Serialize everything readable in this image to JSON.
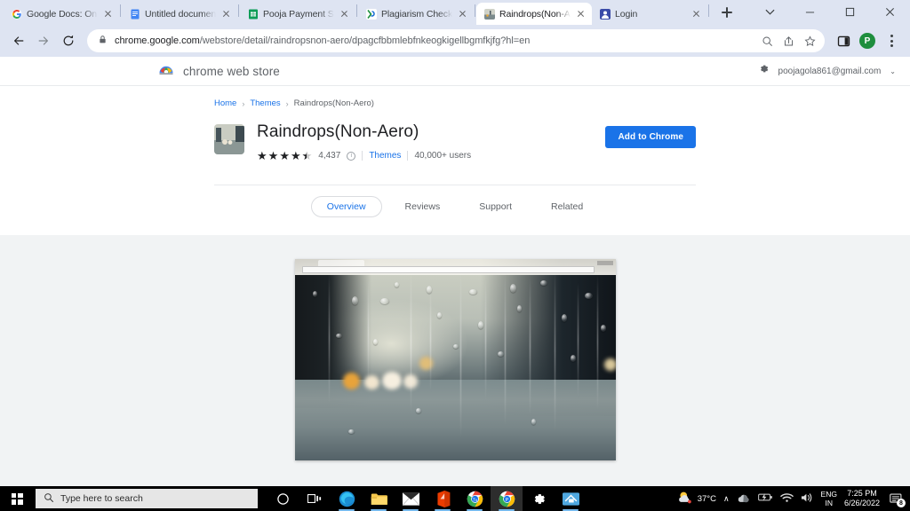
{
  "browser": {
    "tabs": [
      {
        "title": "Google Docs: Online ",
        "favicon": "google-docs-home-icon",
        "active": false
      },
      {
        "title": "Untitled document - G",
        "favicon": "google-docs-icon",
        "active": false
      },
      {
        "title": "Pooja Payment Sheet",
        "favicon": "google-sheets-icon",
        "active": false
      },
      {
        "title": "Plagiarism Checker - ",
        "favicon": "plagiarism-checker-icon",
        "active": false
      },
      {
        "title": "Raindrops(Non-Aero)",
        "favicon": "raindrops-theme-icon",
        "active": true
      },
      {
        "title": "Login",
        "favicon": "login-app-icon",
        "active": false
      }
    ],
    "new_tab_label": "+",
    "window_controls": {
      "tab_search": "tab-search",
      "minimize": "minimize",
      "maximize": "maximize",
      "close": "close"
    },
    "toolbar": {
      "back": "back-arrow",
      "forward": "forward-arrow",
      "reload": "reload",
      "lock": "lock-icon",
      "url_host": "chrome.google.com",
      "url_path": "/webstore/detail/raindropsnon-aero/dpagcfbbmlebfnkeogkigellbgmfkjfg?hl=en",
      "url_full": "chrome.google.com/webstore/detail/raindropsnon-aero/dpagcfbbmlebfnkeogkigellbgmfkjfg?hl=en",
      "icons": [
        "search-icon",
        "share-icon",
        "bookmark-star-icon",
        "side-panel-icon"
      ],
      "profile_initial": "P",
      "profile_color": "#1e8e3e",
      "menu": "three-dot-menu"
    }
  },
  "store": {
    "logo_name": "chrome web store",
    "settings_icon": "gear-icon",
    "account_email": "poojagola861@gmail.com",
    "account_caret": "⌄",
    "breadcrumb": {
      "home": "Home",
      "category": "Themes",
      "current": "Raindrops(Non-Aero)",
      "separator": "›"
    },
    "item": {
      "title": "Raindrops(Non-Aero)",
      "icon": "raindrops-theme-thumbnail",
      "rating_value": "4,437",
      "stars_filled": 4,
      "stars_half": true,
      "info_icon": "info-icon",
      "category_link": "Themes",
      "users": "40,000+ users",
      "add_button": "Add to Chrome",
      "accent_color": "#1a73e8"
    },
    "tabs": [
      {
        "label": "Overview",
        "selected": true
      },
      {
        "label": "Reviews",
        "selected": false
      },
      {
        "label": "Support",
        "selected": false
      },
      {
        "label": "Related",
        "selected": false
      }
    ],
    "screenshot_alt": "raindrops-theme-preview"
  },
  "taskbar": {
    "start": "windows-start-icon",
    "search_placeholder": "Type here to search",
    "search_icon": "search-icon",
    "icons": [
      {
        "name": "cortana-icon"
      },
      {
        "name": "task-view-icon"
      },
      {
        "name": "microsoft-edge-icon"
      },
      {
        "name": "file-explorer-icon"
      },
      {
        "name": "mail-icon"
      },
      {
        "name": "microsoft-office-icon"
      },
      {
        "name": "chrome-tv-icon"
      },
      {
        "name": "chrome-icon"
      },
      {
        "name": "settings-gear-icon"
      },
      {
        "name": "blue-app-icon"
      }
    ],
    "tray": {
      "weather_icon": "partly-sunny-icon",
      "temperature": "37°C",
      "chevron": "∧",
      "cloud_icon": "onedrive-icon",
      "battery_icon": "battery-icon",
      "wifi_icon": "wifi-icon",
      "volume_icon": "volume-icon",
      "language_line1": "ENG",
      "language_line2": "IN",
      "time": "7:25 PM",
      "date": "6/26/2022",
      "notification_icon": "notification-icon",
      "notification_count": "8"
    }
  }
}
